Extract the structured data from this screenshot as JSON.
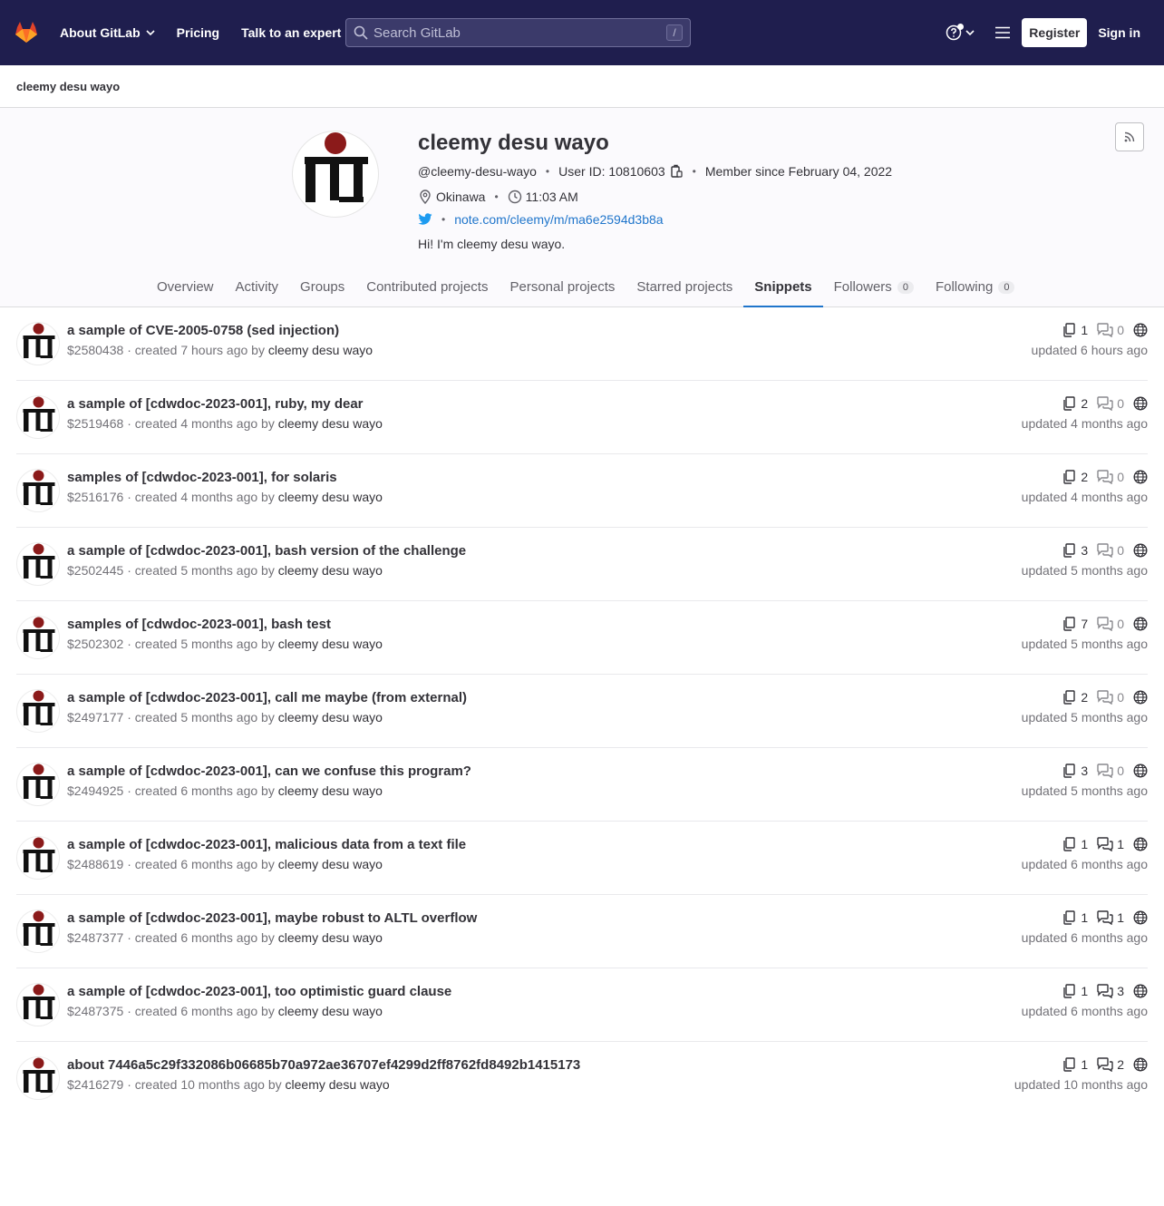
{
  "nav": {
    "about": "About GitLab",
    "pricing": "Pricing",
    "expert": "Talk to an expert",
    "search_placeholder": "Search GitLab",
    "search_shortcut": "/",
    "register": "Register",
    "signin": "Sign in"
  },
  "breadcrumb": "cleemy desu wayo",
  "profile": {
    "name": "cleemy desu wayo",
    "username": "@cleemy-desu-wayo",
    "user_id": "User ID: 10810603",
    "member_since": "Member since February 04, 2022",
    "location": "Okinawa",
    "local_time": "11:03 AM",
    "website": "note.com/cleemy/m/ma6e2594d3b8a",
    "bio": "Hi! I'm cleemy desu wayo."
  },
  "tabs": [
    {
      "label": "Overview"
    },
    {
      "label": "Activity"
    },
    {
      "label": "Groups"
    },
    {
      "label": "Contributed projects"
    },
    {
      "label": "Personal projects"
    },
    {
      "label": "Starred projects"
    },
    {
      "label": "Snippets"
    },
    {
      "label": "Followers",
      "count": "0"
    },
    {
      "label": "Following",
      "count": "0"
    }
  ],
  "snippets": [
    {
      "title": "a sample of CVE-2005-0758 (sed injection)",
      "id": "$2580438",
      "created": "created 7 hours ago by",
      "author": "cleemy desu wayo",
      "files": "1",
      "comments": "0",
      "updated": "updated 6 hours ago"
    },
    {
      "title": "a sample of [cdwdoc-2023-001], ruby, my dear",
      "id": "$2519468",
      "created": "created 4 months ago by",
      "author": "cleemy desu wayo",
      "files": "2",
      "comments": "0",
      "updated": "updated 4 months ago"
    },
    {
      "title": "samples of [cdwdoc-2023-001], for solaris",
      "id": "$2516176",
      "created": "created 4 months ago by",
      "author": "cleemy desu wayo",
      "files": "2",
      "comments": "0",
      "updated": "updated 4 months ago"
    },
    {
      "title": "a sample of [cdwdoc-2023-001], bash version of the challenge",
      "id": "$2502445",
      "created": "created 5 months ago by",
      "author": "cleemy desu wayo",
      "files": "3",
      "comments": "0",
      "updated": "updated 5 months ago"
    },
    {
      "title": "samples of [cdwdoc-2023-001], bash test",
      "id": "$2502302",
      "created": "created 5 months ago by",
      "author": "cleemy desu wayo",
      "files": "7",
      "comments": "0",
      "updated": "updated 5 months ago"
    },
    {
      "title": "a sample of [cdwdoc-2023-001], call me maybe (from external)",
      "id": "$2497177",
      "created": "created 5 months ago by",
      "author": "cleemy desu wayo",
      "files": "2",
      "comments": "0",
      "updated": "updated 5 months ago"
    },
    {
      "title": "a sample of [cdwdoc-2023-001], can we confuse this program?",
      "id": "$2494925",
      "created": "created 6 months ago by",
      "author": "cleemy desu wayo",
      "files": "3",
      "comments": "0",
      "updated": "updated 5 months ago"
    },
    {
      "title": "a sample of [cdwdoc-2023-001], malicious data from a text file",
      "id": "$2488619",
      "created": "created 6 months ago by",
      "author": "cleemy desu wayo",
      "files": "1",
      "comments": "1",
      "updated": "updated 6 months ago"
    },
    {
      "title": "a sample of [cdwdoc-2023-001], maybe robust to ALTL overflow",
      "id": "$2487377",
      "created": "created 6 months ago by",
      "author": "cleemy desu wayo",
      "files": "1",
      "comments": "1",
      "updated": "updated 6 months ago"
    },
    {
      "title": "a sample of [cdwdoc-2023-001], too optimistic guard clause",
      "id": "$2487375",
      "created": "created 6 months ago by",
      "author": "cleemy desu wayo",
      "files": "1",
      "comments": "3",
      "updated": "updated 6 months ago"
    },
    {
      "title": "about 7446a5c29f332086b06685b70a972ae36707ef4299d2ff8762fd8492b1415173",
      "id": "$2416279",
      "created": "created 10 months ago by",
      "author": "cleemy desu wayo",
      "files": "1",
      "comments": "2",
      "updated": "updated 10 months ago"
    }
  ],
  "colors": {
    "navbar": "#1f1e4e",
    "link": "#1f75cb",
    "active_tab_underline": "#1f75cb",
    "avatar_red": "#8b1a1a"
  }
}
